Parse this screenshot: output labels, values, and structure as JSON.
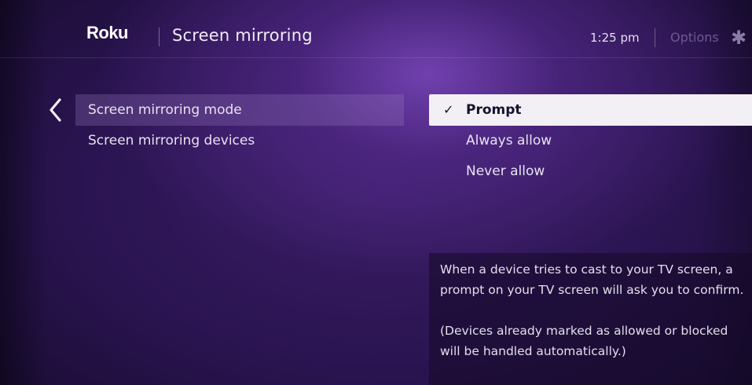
{
  "header": {
    "logo_text": "Roku",
    "title": "Screen mirroring",
    "time": "1:25 pm",
    "options_label": "Options",
    "options_icon": "asterisk-icon"
  },
  "sidebar": {
    "back_icon": "chevron-left-icon",
    "items": [
      {
        "label": "Screen mirroring mode",
        "selected": true
      },
      {
        "label": "Screen mirroring devices",
        "selected": false
      }
    ]
  },
  "mode_options": {
    "items": [
      {
        "label": "Prompt",
        "checked": true
      },
      {
        "label": "Always allow",
        "checked": false
      },
      {
        "label": "Never allow",
        "checked": false
      }
    ]
  },
  "description": {
    "paragraph_1": "When a device tries to cast to your TV screen, a prompt on your TV screen will ask you to confirm.",
    "paragraph_2": "(Devices already marked as allowed or blocked will be handled automatically.)"
  },
  "colors": {
    "background": "#2a1450",
    "highlight": "#f2f0f4",
    "accent_glow": "#7c48be"
  }
}
